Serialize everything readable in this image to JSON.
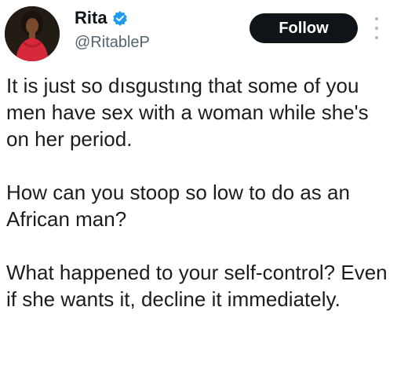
{
  "author": {
    "display_name": "Rita",
    "handle": "@RitableP",
    "verified": true,
    "avatar": "profile-photo-woman-red-dress"
  },
  "actions": {
    "follow_label": "Follow",
    "more_icon": "vertical-ellipsis"
  },
  "tweet": {
    "paragraphs": [
      "It is just so dısgustıng that some of you men have sex with a woman while she's on her period.",
      "How can you stoop so low to do as an African man?",
      "What happened to your self-control? Even if she wants it, decline it immediately."
    ]
  },
  "colors": {
    "follow_bg": "#0f1419",
    "verified_badge": "#1d9bf0",
    "handle_text": "#536471"
  }
}
